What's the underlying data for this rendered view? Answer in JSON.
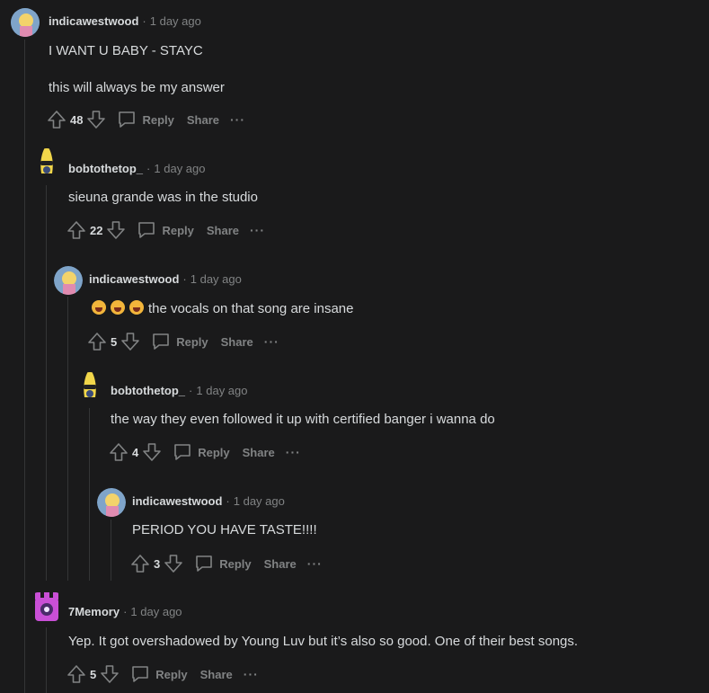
{
  "comments": [
    {
      "username": "indicawestwood",
      "time": "1 day ago",
      "lines": [
        "I WANT U BABY - STAYC",
        "this will always be my answer"
      ],
      "votes": "48",
      "avatar": "indica-avatar"
    },
    {
      "username": "bobtothetop_",
      "time": "1 day ago",
      "lines": [
        "sieuna grande was in the studio"
      ],
      "votes": "22",
      "avatar": "banana-avatar"
    },
    {
      "username": "indicawestwood",
      "time": "1 day ago",
      "lines": [
        "the vocals on that song are insane"
      ],
      "emoji_count": 3,
      "votes": "5",
      "avatar": "indica-avatar"
    },
    {
      "username": "bobtothetop_",
      "time": "1 day ago",
      "lines": [
        "the way they even followed it up with certified banger i wanna do"
      ],
      "votes": "4",
      "avatar": "banana-avatar"
    },
    {
      "username": "indicawestwood",
      "time": "1 day ago",
      "lines": [
        "PERIOD YOU HAVE TASTE!!!!"
      ],
      "votes": "3",
      "avatar": "indica-avatar"
    },
    {
      "username": "7Memory",
      "time": "1 day ago",
      "lines": [
        "Yep. It got overshadowed by Young Luv but it’s also so good. One of their best songs."
      ],
      "votes": "5",
      "avatar": "castle-avatar"
    }
  ],
  "actions": {
    "reply": "Reply",
    "share": "Share",
    "more": "···",
    "separator": "·"
  },
  "icons": {
    "upvote": "upvote-arrow-icon",
    "downvote": "downvote-arrow-icon",
    "reply": "speech-bubble-icon",
    "emoji": "screaming-face-emoji"
  },
  "colors": {
    "background": "#1a1a1b",
    "text": "#d7dadc",
    "muted": "#818384",
    "thread_line": "#343536"
  }
}
